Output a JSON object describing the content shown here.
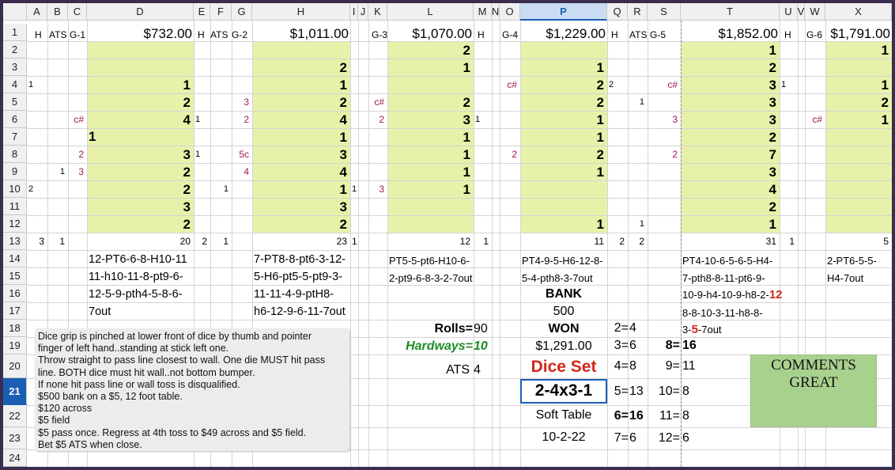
{
  "columns": [
    "A",
    "B",
    "C",
    "D",
    "E",
    "F",
    "G",
    "H",
    "I",
    "J",
    "K",
    "L",
    "M",
    "N",
    "O",
    "P",
    "Q",
    "R",
    "S",
    "T",
    "U",
    "V",
    "W",
    "X"
  ],
  "rows": [
    "1",
    "2",
    "3",
    "4",
    "5",
    "6",
    "7",
    "8",
    "9",
    "10",
    "11",
    "12",
    "13",
    "14",
    "15",
    "16",
    "17",
    "18",
    "19",
    "20",
    "21",
    "22",
    "23",
    "24"
  ],
  "selected": {
    "column": "P",
    "row": "21"
  },
  "row1": {
    "a": "H",
    "b": "ATS",
    "c": "G-1",
    "d": "$732.00",
    "e": "H",
    "f": "ATS",
    "g": "G-2",
    "h": "$1,011.00",
    "k": "G-3",
    "l": "$1,070.00",
    "m": "H",
    "o": "G-4",
    "p": "$1,229.00",
    "q": "H",
    "r": "ATS",
    "s": "G-5",
    "t": "$1,852.00",
    "u": "H",
    "w": "G-6",
    "x": "$1,791.00"
  },
  "grid": {
    "A": {
      "4": "1",
      "10": "2",
      "13": "3"
    },
    "B": {
      "9": "1",
      "13": "1"
    },
    "C": {
      "6": "c#",
      "8": "2",
      "9": "3"
    },
    "D": {
      "4": "1",
      "5": "2",
      "6": "4",
      "8": "3",
      "9": "2",
      "10": "2",
      "11": "3",
      "12": "2",
      "13": "20"
    },
    "D7": "1",
    "E": {
      "6": "1",
      "8": "1",
      "13": "2"
    },
    "F": {
      "10": "1",
      "13": "1"
    },
    "G": {
      "5": "3",
      "6": "2",
      "8": "5c",
      "9": "4"
    },
    "H": {
      "3": "2",
      "4": "1",
      "5": "2",
      "6": "4",
      "7": "1",
      "8": "3",
      "9": "4",
      "10": "1",
      "11": "3",
      "12": "2",
      "13": "23"
    },
    "I": {
      "10": "1",
      "13": "1"
    },
    "K": {
      "5": "c#",
      "6": "2",
      "10": "3"
    },
    "L": {
      "2": "2",
      "3": "1",
      "5": "2",
      "6": "3",
      "7": "1",
      "8": "1",
      "9": "1",
      "10": "1",
      "13": "12"
    },
    "M": {
      "6": "1",
      "13": "1"
    },
    "O": {
      "4": "c#",
      "8": "2"
    },
    "P": {
      "3": "1",
      "4": "2",
      "5": "2",
      "6": "1",
      "7": "1",
      "8": "2",
      "9": "1",
      "12": "1",
      "13": "11"
    },
    "Q": {
      "4": "2",
      "13": "2"
    },
    "R": {
      "5": "1",
      "12": "1",
      "13": "2"
    },
    "S": {
      "4": "c#",
      "6": "3",
      "8": "2"
    },
    "T": {
      "2": "1",
      "3": "2",
      "4": "3",
      "5": "3",
      "6": "3",
      "7": "2",
      "8": "7",
      "9": "3",
      "10": "4",
      "11": "2",
      "12": "1",
      "13": "31"
    },
    "U": {
      "4": "1",
      "13": "1"
    },
    "W": {
      "6": "c#"
    },
    "X": {
      "2": "1",
      "4": "1",
      "5": "2",
      "6": "1",
      "13": "5"
    }
  },
  "sequences": {
    "d": [
      "12-PT6-6-8-H10-11",
      "11-h10-11-8-pt9-6-",
      "12-5-9-pth4-5-8-6-",
      "7out"
    ],
    "h": [
      "7-PT8-8-pt6-3-12-",
      "5-H6-pt5-5-pt9-3-",
      "11-11-4-9-ptH8-",
      "h6-12-9-6-11-7out"
    ],
    "l": [
      "PT5-5-pt6-H10-6-",
      "2-pt9-6-8-3-2-7out"
    ],
    "p": [
      "PT4-9-5-H6-12-8-",
      "5-4-pth8-3-7out"
    ],
    "t": [
      "PT4-10-6-5-6-5-H4-",
      "7-pth8-8-11-pt6-9-",
      "10-9-h4-10-9-h8-2-",
      "8-8-10-3-11-h8-8-",
      "3-",
      "-7out"
    ],
    "t_red": [
      "12",
      "5"
    ],
    "x": [
      "2-PT6-5-5-",
      "H4-7out"
    ]
  },
  "summary": {
    "bank_label": "BANK",
    "bank_value": "500",
    "won_label": "WON",
    "won_value": "$1,291.00",
    "dice_set_label": "Dice Set",
    "dice_set_value": "2-4x3-1",
    "table": "Soft Table",
    "date": "10-2-22",
    "rolls_label": "Rolls=",
    "rolls_value": "90",
    "hardways_label": "Hardways=",
    "hardways_value": "10",
    "ats_label": "ATS",
    "ats_value": "4"
  },
  "counts": [
    {
      "k": "2=",
      "v": "4"
    },
    {
      "k": "3=",
      "v": "6"
    },
    {
      "k": "4=",
      "v": "8"
    },
    {
      "k": "5=",
      "v": "13"
    },
    {
      "k": "6=",
      "v": "16"
    },
    {
      "k": "7=",
      "v": "6"
    },
    {
      "k": "8=",
      "v": "16"
    },
    {
      "k": "9=",
      "v": "11"
    },
    {
      "k": "10=",
      "v": "8"
    },
    {
      "k": "11=",
      "v": "8"
    },
    {
      "k": "12=",
      "v": "6"
    }
  ],
  "notes": [
    "Dice grip is pinched at lower front of dice by thumb and pointer",
    "finger of left hand..standing at stick left one.",
    "Throw straight to pass line closest to wall. One die MUST hit pass",
    "line. BOTH dice must hit wall..not bottom bumper.",
    "If none hit pass line or wall toss is disqualified.",
    "$500 bank  on a $5, 12 foot table.",
    "$120 across",
    "$5 field",
    "$5 pass once.   Regress at 4th toss to $49 across and $5 field.",
    "Bet $5 ATS when close."
  ],
  "comments": [
    "COMMENTS",
    "GREAT"
  ],
  "colors": {
    "yellow": "#e8f1a9",
    "magenta": "#a01850",
    "red": "#d0281c",
    "green": "#1e8c28",
    "comment_bg": "#a9d18e",
    "select": "#1a5fb4"
  }
}
